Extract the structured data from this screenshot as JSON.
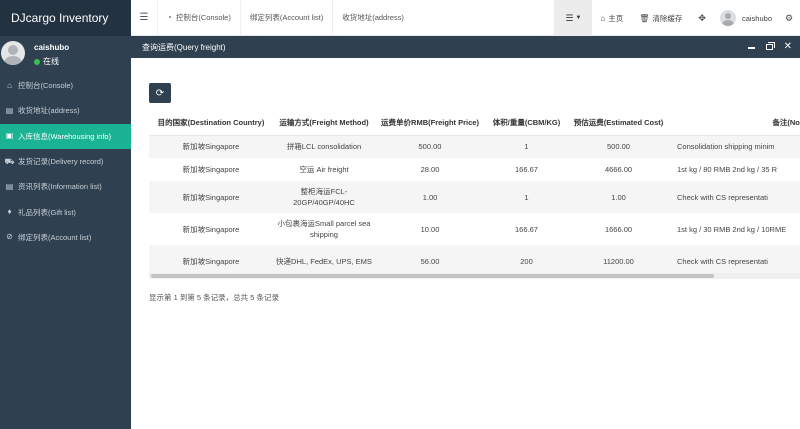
{
  "app": {
    "title": "DJcargo Inventory"
  },
  "user": {
    "name": "caishubo",
    "status": "在线"
  },
  "sidebar": {
    "items": [
      {
        "icon": "home-icon",
        "glyph": "⌂",
        "label": "控制台(Console)",
        "active": false
      },
      {
        "icon": "list-icon",
        "glyph": "▤",
        "label": "收货地址(address)",
        "active": false
      },
      {
        "icon": "inbox-icon",
        "glyph": "▣",
        "label": "入库信息(Warehousing info)",
        "active": true
      },
      {
        "icon": "truck-icon",
        "glyph": "⛟",
        "label": "发货记录(Delivery record)",
        "active": false
      },
      {
        "icon": "list-icon",
        "glyph": "▤",
        "label": "资讯列表(Information list)",
        "active": false
      },
      {
        "icon": "gift-icon",
        "glyph": "♦",
        "label": "礼品列表(Gift list)",
        "active": false
      },
      {
        "icon": "link-icon",
        "glyph": "⊘",
        "label": "绑定列表(Account list)",
        "active": false
      }
    ]
  },
  "topbar": {
    "tabs": [
      {
        "label": "控制台(Console)",
        "icon": "dashboard-icon"
      },
      {
        "label": "绑定列表(Account list)"
      },
      {
        "label": "收货地址(address)"
      }
    ],
    "home_label": "主页",
    "clear_cache_label": "清除缓存",
    "user_name": "caishubo"
  },
  "panel": {
    "title": "查询运费(Query freight)"
  },
  "table": {
    "headers": [
      "目的国家(Destination Country)",
      "运输方式(Freight Method)",
      "运费单价RMB(Freight Price)",
      "体积/重量(CBM/KG)",
      "预估运费(Estimated Cost)",
      "备注(Note)"
    ],
    "rows": [
      {
        "country": "新加坡Singapore",
        "method": "拼箱LCL consolidation",
        "price": "500.00",
        "unit": "1",
        "cost": "500.00",
        "note": "Consolidation shipping minim"
      },
      {
        "country": "新加坡Singapore",
        "method": "空运 Air freight",
        "price": "28.00",
        "unit": "166.67",
        "cost": "4666.00",
        "note": "1st kg / 80 RMB 2nd kg / 35 R"
      },
      {
        "country": "新加坡Singapore",
        "method": "整柜海运FCL-20GP/40GP/40HC",
        "price": "1.00",
        "unit": "1",
        "cost": "1.00",
        "note": "Check with CS representati"
      },
      {
        "country": "新加坡Singapore",
        "method": "小包裹海运Small parcel sea shipping",
        "price": "10.00",
        "unit": "166.67",
        "cost": "1666.00",
        "note": "1st kg / 30 RMB 2nd kg / 10RME"
      },
      {
        "country": "新加坡Singapore",
        "method": "快递DHL, FedEx, UPS, EMS",
        "price": "56.00",
        "unit": "200",
        "cost": "11200.00",
        "note": "Check with CS representati"
      }
    ]
  },
  "pager": {
    "info": "显示第 1 到第 5 条记录，总共 5 条记录"
  }
}
